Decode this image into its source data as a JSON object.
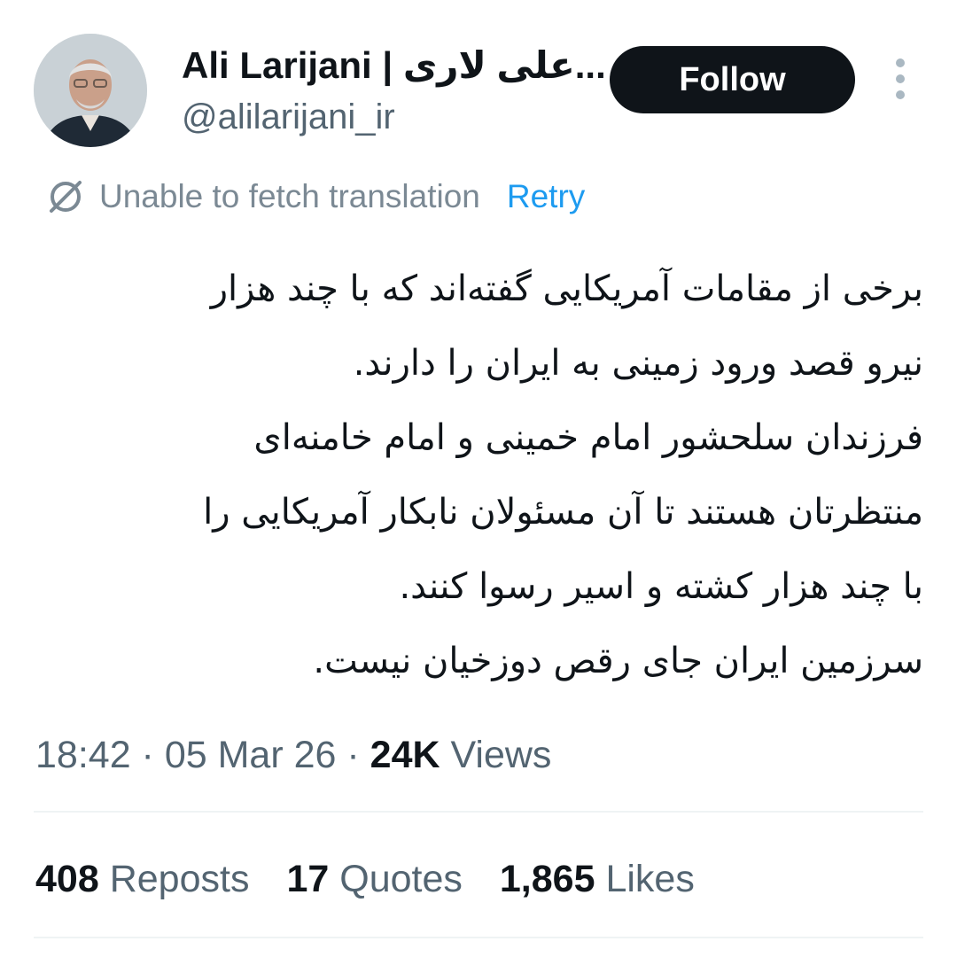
{
  "author": {
    "name": "Ali Larijani | علی لاری...",
    "handle": "@alilarijani_ir"
  },
  "actions": {
    "follow_label": "Follow"
  },
  "translation": {
    "status": "Unable to fetch translation",
    "retry_label": "Retry"
  },
  "tweet": {
    "lines": [
      "برخی از مقامات آمریکایی گفته‌اند که با چند هزار",
      "نیرو قصد ورود زمینی به ایران را دارند.",
      "فرزندان سلحشور امام خمینی و امام خامنه‌ای",
      "منتظرتان هستند تا آن مسئولان نابکار آمریکایی را",
      "با چند هزار کشته و اسیر رسوا کنند.",
      "سرزمین ایران جای رقص دوزخیان نیست."
    ]
  },
  "meta": {
    "time": "18:42",
    "sep1": " · ",
    "date": "05 Mar 26",
    "sep2": " · ",
    "views_count": "24K",
    "views_label": " Views"
  },
  "stats": {
    "reposts_count": "408",
    "reposts_label": " Reposts",
    "quotes_count": "17",
    "quotes_label": " Quotes",
    "likes_count": "1,865",
    "likes_label": " Likes"
  },
  "colors": {
    "accent": "#1d9bf0",
    "text": "#0f1419",
    "secondary": "#536471",
    "button": "#0f1419"
  },
  "icons": {
    "translate_unavailable": "no-translation-icon",
    "more": "more-options-icon"
  }
}
